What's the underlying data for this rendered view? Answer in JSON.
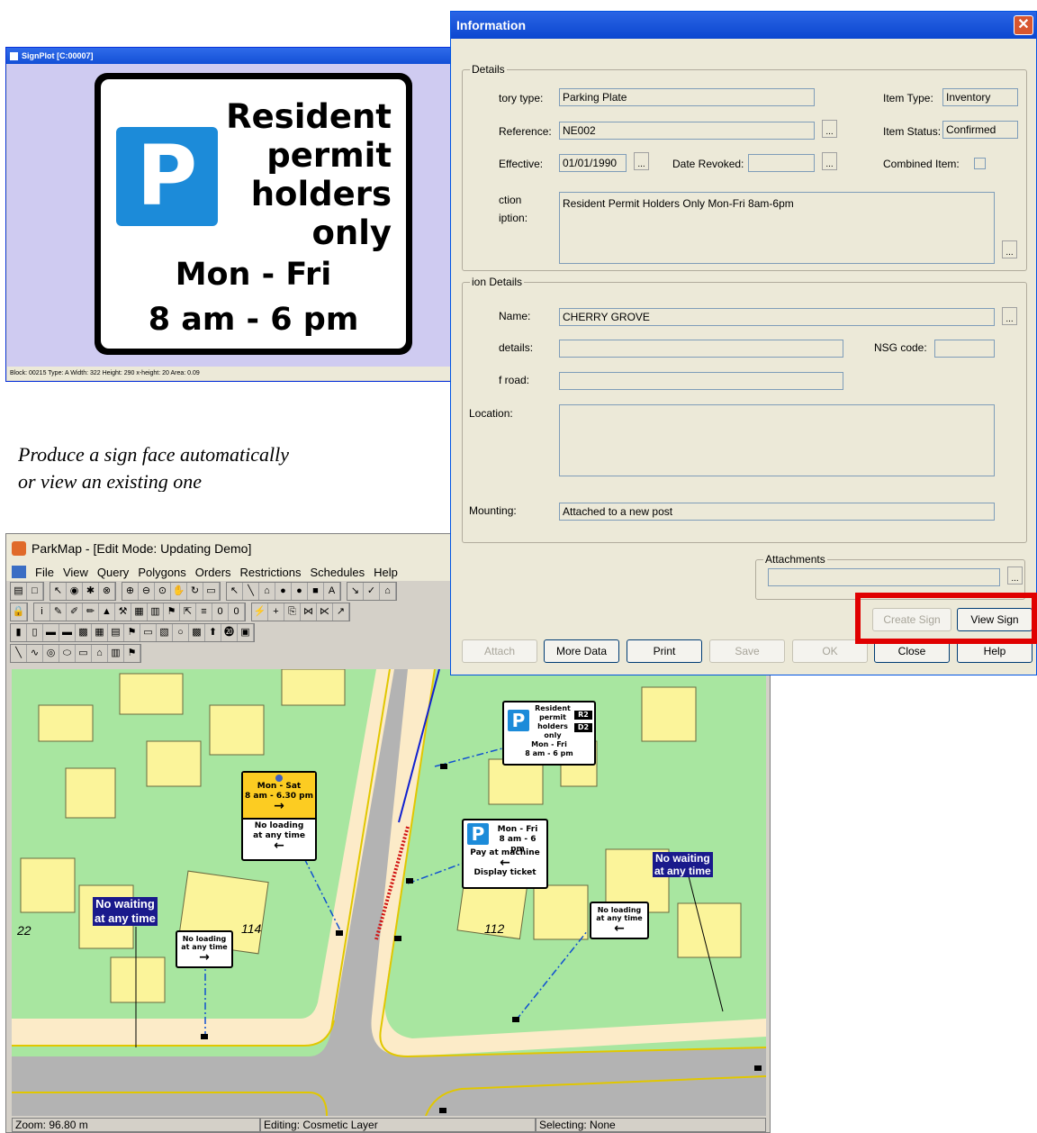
{
  "signplot": {
    "title": "SignPlot [C:00007]",
    "sign": {
      "p": "P",
      "line1": "Resident",
      "line2": "permit",
      "line3": "holders",
      "line4": "only",
      "days": "Mon - Fri",
      "hours": "8 am - 6 pm"
    },
    "status": "Block: 00215   Type: A   Width: 322   Height: 290   x-height: 20   Area: 0.09"
  },
  "caption": {
    "line1": "Produce a sign face automatically",
    "line2": "or view an existing one"
  },
  "parkmap": {
    "title": "ParkMap - [Edit Mode: Updating Demo]",
    "menu": [
      "File",
      "View",
      "Query",
      "Polygons",
      "Orders",
      "Restrictions",
      "Schedules",
      "Help"
    ],
    "status": {
      "zoom": "Zoom: 96.80 m",
      "editing": "Editing: Cosmetic Layer",
      "selecting": "Selecting: None"
    },
    "map": {
      "house_numbers": [
        "22",
        "114",
        "112"
      ],
      "no_waiting": [
        "No waiting",
        "at any time"
      ],
      "sign_sat": {
        "days": "Mon - Sat",
        "hours": "8 am - 6.30 pm",
        "arrow": "→",
        "l1": "No loading",
        "l2": "at any time",
        "arrow2": "←"
      },
      "sign_resident": {
        "p": "P",
        "l1": "Resident",
        "l2": "permit",
        "l3": "holders",
        "l4": "only",
        "days": "Mon - Fri",
        "hours": "8 am - 6 pm",
        "r2": "R2",
        "d2": "D2"
      },
      "sign_pay": {
        "p": "P",
        "days": "Mon - Fri",
        "hours": "8 am - 6 pm",
        "pay": "Pay at machine",
        "arrow": "←",
        "display": "Display ticket"
      },
      "sign_noload_left": {
        "l1": "No loading",
        "l2": "at any time",
        "arrow": "→"
      },
      "sign_noload_right": {
        "l1": "No loading",
        "l2": "at any time",
        "arrow": "←"
      }
    }
  },
  "info": {
    "title": "Information",
    "close": "✕",
    "group1": "Details",
    "inventory_type_label": "tory type:",
    "inventory_type": "Parking Plate",
    "reference_label": "Reference:",
    "reference": "NE002",
    "effective_label": "Effective:",
    "effective": "01/01/1990",
    "date_revoked_label": "Date Revoked:",
    "date_revoked": "",
    "item_type_label": "Item Type:",
    "item_type": "Inventory",
    "item_status_label": "Item Status:",
    "item_status": "Confirmed",
    "combined_label": "Combined Item:",
    "description_label1": "ction",
    "description_label2": "iption:",
    "description": "Resident Permit Holders Only Mon-Fri 8am-6pm",
    "group2": "ion Details",
    "name_label": "Name:",
    "name": "CHERRY GROVE",
    "details_label": "details:",
    "nsg_label": "NSG code:",
    "road_label": "f road:",
    "location_label": "Location:",
    "mounting_label": "Mounting:",
    "mounting": "Attached to a new post",
    "attachments_label": "Attachments",
    "ellipsis": "...",
    "buttons": {
      "create_sign": "Create Sign",
      "view_sign": "View Sign",
      "attach": "Attach",
      "more_data": "More Data",
      "print": "Print",
      "save": "Save",
      "ok": "OK",
      "close": "Close",
      "help": "Help"
    }
  },
  "colors": {
    "highlight": "#e00000",
    "sign_blue": "#1c8bd9",
    "map_green": "#a8e6a0",
    "building": "#fbf49a"
  }
}
